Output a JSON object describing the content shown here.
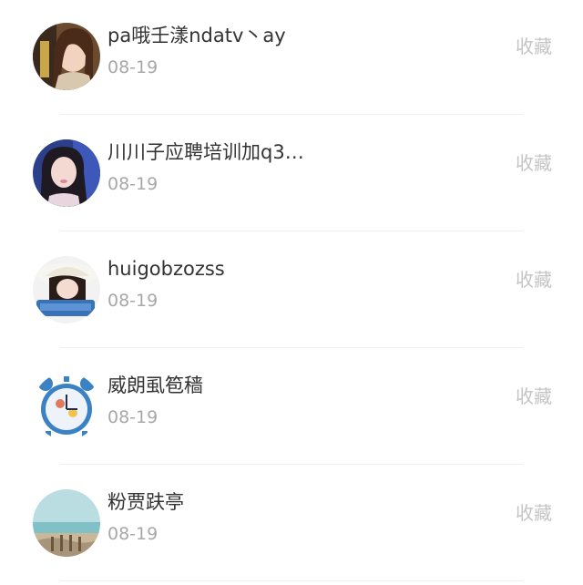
{
  "favorite_list": {
    "items": [
      {
        "name": "pa哦壬漾ndatv丶ay",
        "date": "08-19",
        "action": "收藏",
        "avatar": "girl-with-scarf-photo"
      },
      {
        "name": "川川子应聘培训加q3…",
        "date": "08-19",
        "action": "收藏",
        "avatar": "girl-portrait-photo"
      },
      {
        "name": "huigobzozss",
        "date": "08-19",
        "action": "收藏",
        "avatar": "girl-with-hat-photo"
      },
      {
        "name": "威朗虱笣穑",
        "date": "08-19",
        "action": "收藏",
        "avatar": "alarm-clock-picture"
      },
      {
        "name": "粉贾趺亭",
        "date": "08-19",
        "action": "收藏",
        "avatar": "seaside-landscape-photo"
      }
    ]
  }
}
